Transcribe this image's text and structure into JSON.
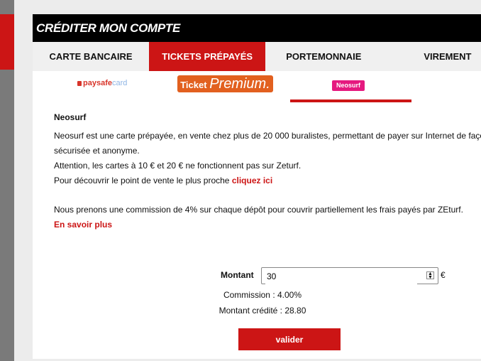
{
  "panel": {
    "title": "CRÉDITER MON COMPTE"
  },
  "tabs": [
    {
      "label": "CARTE BANCAIRE",
      "active": false
    },
    {
      "label": "TICKETS PRÉPAYÉS",
      "active": true
    },
    {
      "label": "PORTEMONNAIE",
      "active": false
    },
    {
      "label": "VIREMENT",
      "active": false
    }
  ],
  "methods": {
    "paysafe": {
      "brand": "paysafe",
      "suffix": "card"
    },
    "ticket_premium": {
      "prefix": "Ticket",
      "name": "Premium."
    },
    "neosurf": {
      "label": "Neosurf",
      "selected": true
    }
  },
  "content": {
    "heading": "Neosurf",
    "line1": "Neosurf est une carte prépayée, en vente chez plus de 20 000 buralistes, permettant de payer sur Internet de façon",
    "line2": "sécurisée et anonyme.",
    "line3": "Attention, les cartes à 10 € et 20 € ne fonctionnent pas sur Zeturf.",
    "line4_prefix": "Pour découvrir le point de vente le plus proche ",
    "line4_link": "cliquez ici",
    "commission_text": "Nous prenons une commission de 4% sur chaque dépôt pour couvrir partiellement les frais payés par ZEturf.",
    "more_link": "En savoir plus"
  },
  "form": {
    "amount_label": "Montant",
    "amount_value": "30",
    "currency": "€",
    "commission": "Commission : 4.00%",
    "credited": "Montant crédité : 28.80",
    "submit_label": "valider"
  },
  "colors": {
    "accent": "#cc1515",
    "title_bar": "#000000",
    "tab_bar": "#f0f0f0",
    "background": "#ececec"
  }
}
